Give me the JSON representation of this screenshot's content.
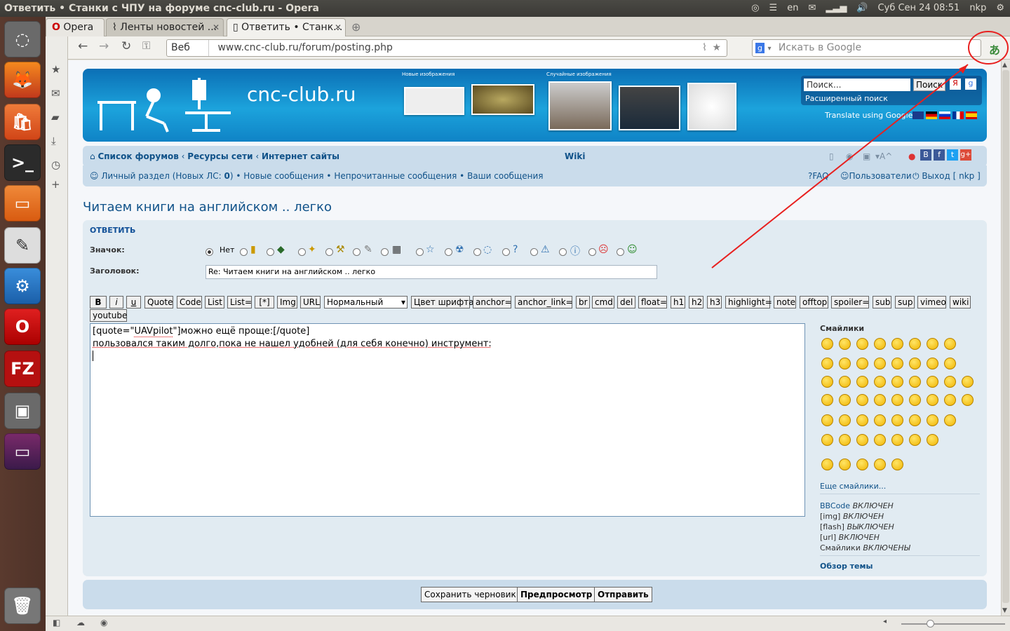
{
  "window": {
    "title": "Ответить • Станки с ЧПУ на форуме cnc-club.ru - Opera",
    "lang": "en",
    "clock": "Суб Сен 24 08:51",
    "user": "nkp"
  },
  "tabs": {
    "opera": "Opera",
    "feeds": "Ленты новостей ...",
    "active": "Ответить • Станк..."
  },
  "nav": {
    "badge": "Веб",
    "url": "www.cnc-club.ru/forum/posting.php",
    "search_placeholder": "Искать в Google"
  },
  "banner": {
    "site": "cnc-club.ru",
    "new_images": "Новые изображения",
    "random_images": "Случайные изображения",
    "search_value": "Поиск...",
    "search_btn": "Поиск",
    "adv_search": "Расширенный поиск",
    "translate": "Translate using Google"
  },
  "breadcrumb": {
    "home": "Список форумов",
    "res": "Ресурсы сети",
    "sites": "Интернет сайты",
    "wiki": "Wiki"
  },
  "usernav": {
    "personal": "Личный раздел (Новых ЛС: ",
    "count": "0",
    "close": ")",
    "new": "Новые сообщения",
    "unread": "Непрочитанные сообщения",
    "yours": "Ваши сообщения",
    "faq": "FAQ",
    "users": "Пользователи",
    "logout": "Выход [ nkp ]"
  },
  "topic": {
    "title": "Читаем книги на английском .. легко",
    "reply": "ОТВЕТИТЬ",
    "icon_label": "Значок:",
    "none": "Нет",
    "subject_label": "Заголовок:",
    "subject": "Re: Читаем книги на английском .. легко"
  },
  "bbcode": [
    "B",
    "i",
    "u",
    "Quote",
    "Code",
    "List",
    "List=",
    "[*]",
    "Img",
    "URL"
  ],
  "font_size": "Нормальный",
  "bbcode2": [
    "Цвет шрифта",
    "anchor=",
    "anchor_link=",
    "br",
    "cmd",
    "del",
    "float=",
    "h1",
    "h2",
    "h3",
    "highlight=",
    "note",
    "offtop",
    "spoiler=",
    "sub",
    "sup",
    "vimeo",
    "wiki"
  ],
  "youtube": "youtube",
  "message": {
    "line1_open": "[quote=\"",
    "user": "UAVpilot",
    "line1_mid": "\"]можно ещё проще:[/quote]",
    "line2": "пользовался таким долго,пока не нашел удобней (для себя конечно) инструмент:"
  },
  "smilies": {
    "title": "Смайлики",
    "more": "Еще смайлики..."
  },
  "status": {
    "bbcode": "BBCode",
    "bbcode_v": "ВКЛЮЧЕН",
    "img": "[img]",
    "img_v": "ВКЛЮЧЕН",
    "flash": "[flash]",
    "flash_v": "ВЫКЛЮЧЕН",
    "url": "[url]",
    "url_v": "ВКЛЮЧЕН",
    "smilies": "Смайлики",
    "smilies_v": "ВКЛЮЧЕНЫ",
    "review": "Обзор темы"
  },
  "buttons": {
    "draft": "Сохранить черновик",
    "preview": "Предпросмотр",
    "submit": "Отправить"
  },
  "colors": {
    "link": "#105289",
    "annot": "#e8201f"
  }
}
